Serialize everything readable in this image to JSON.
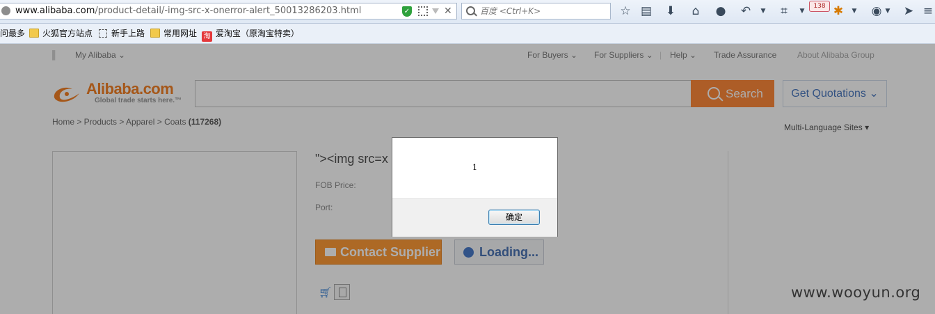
{
  "browser": {
    "url_host": "www.alibaba.com",
    "url_path": "/product-detail/-img-src-x-onerror-alert_50013286203.html",
    "search_placeholder": "百度 <Ctrl+K>",
    "badge_count": "138"
  },
  "bookmarks": [
    {
      "label": "问最多"
    },
    {
      "label": "火狐官方站点"
    },
    {
      "label": "新手上路"
    },
    {
      "label": "常用网址"
    },
    {
      "label": "爱淘宝（原淘宝特卖）"
    }
  ],
  "topnav": {
    "my_alibaba": "My Alibaba ⌄",
    "for_buyers": "For Buyers ⌄",
    "for_suppliers": "For Suppliers ⌄",
    "help": "Help ⌄",
    "trade_assurance": "Trade Assurance",
    "about": "About Alibaba Group"
  },
  "logo": {
    "word": "Alibaba.com",
    "tagline": "Global trade starts here.™"
  },
  "search": {
    "button_label": "Search"
  },
  "quotations": {
    "label": "Get Quotations ⌄"
  },
  "breadcrumb": {
    "path": "Home > Products > Apparel > Coats ",
    "count": "(117268)"
  },
  "multi_language": {
    "label": "Multi-Language Sites ▾"
  },
  "product": {
    "title": "\"><img src=x",
    "fob_label": "FOB Price:",
    "port_label": "Port:",
    "contact_label": "Contact Supplier",
    "loading_label": "Loading..."
  },
  "dialog": {
    "message": "1",
    "ok_label": "确定"
  },
  "watermark": "www.wooyun.org",
  "colors": {
    "accent_orange": "#ff7519",
    "link_blue": "#2e62b5"
  }
}
